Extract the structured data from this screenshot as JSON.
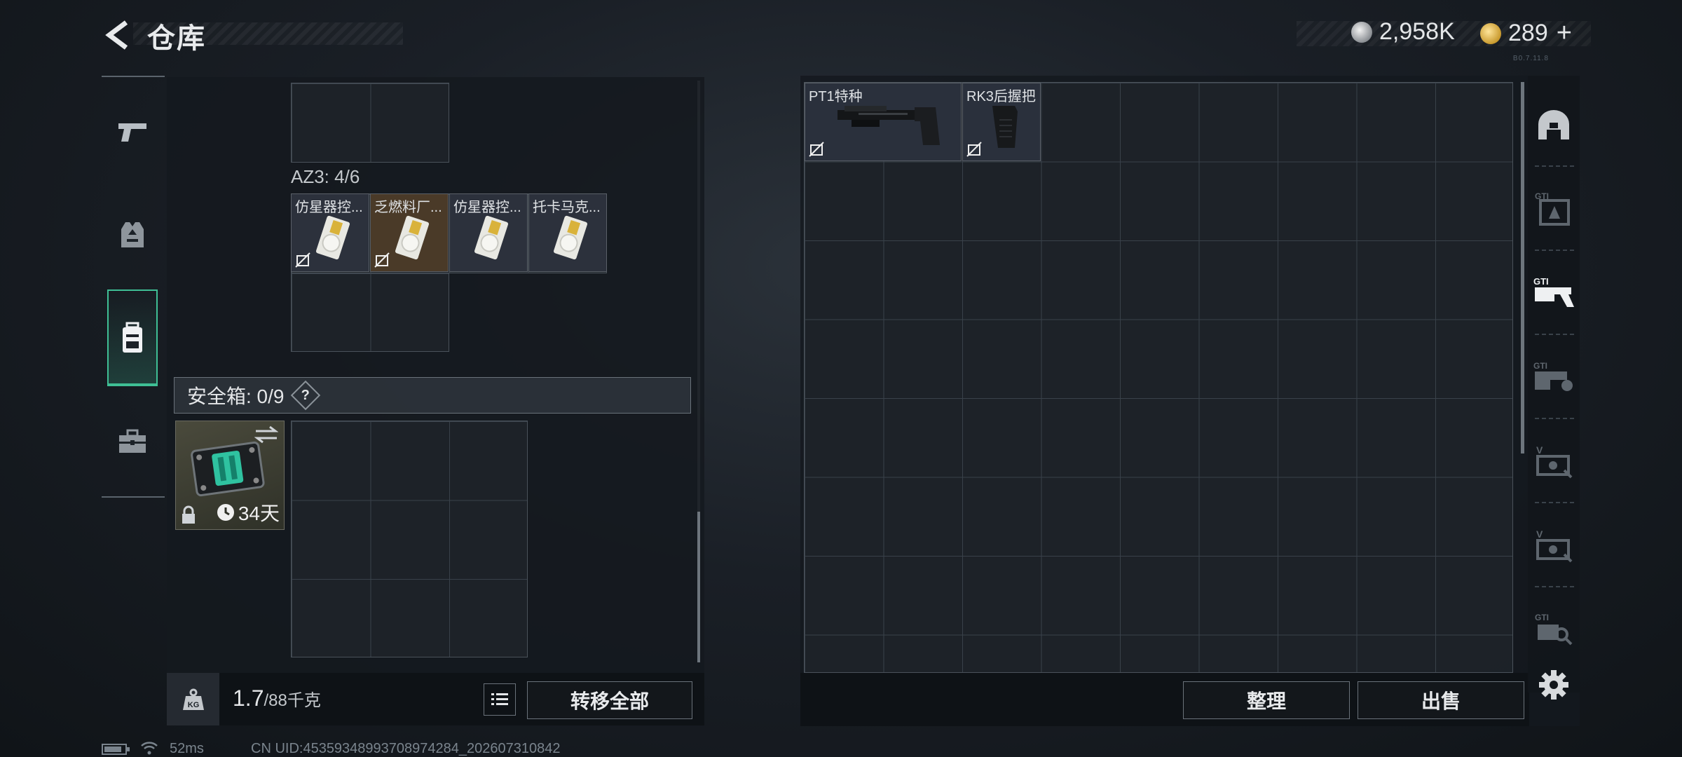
{
  "header": {
    "title": "仓库",
    "currency_silver": "2,958K",
    "currency_gold": "289",
    "plus_label": "+",
    "version": "B0.7.11.8"
  },
  "left_nav": {
    "items": [
      {
        "icon": "pistol-icon"
      },
      {
        "icon": "vest-icon"
      },
      {
        "icon": "backpack-icon",
        "active": true
      },
      {
        "icon": "briefcase-icon"
      }
    ]
  },
  "inventory": {
    "container_label": "AZ3: 4/6",
    "items": [
      {
        "name": "仿星器控...",
        "icon": "keycard-icon"
      },
      {
        "name": "乏燃料厂...",
        "icon": "keycard-icon"
      },
      {
        "name": "仿星器控...",
        "icon": "keycard-icon"
      },
      {
        "name": "托卡马克...",
        "icon": "keycard-icon"
      }
    ],
    "safe_box": {
      "label": "安全箱: 0/9",
      "help": "?",
      "days_left": "34天"
    },
    "weight_current": "1.7",
    "weight_max": "/88千克",
    "transfer_all": "转移全部"
  },
  "stash": {
    "items": [
      {
        "name": "PT1特种",
        "icon": "rifle-stock-icon"
      },
      {
        "name": "RK3后握把",
        "icon": "rear-grip-icon"
      }
    ],
    "sort_label": "整理",
    "sell_label": "出售"
  },
  "right_nav": {
    "items": [
      {
        "icon": "helmet-icon"
      },
      {
        "icon": "gti-armor-icon"
      },
      {
        "icon": "gti-weapon-icon",
        "active": true
      },
      {
        "icon": "gti-ammo-icon"
      },
      {
        "icon": "v-equipment-icon"
      },
      {
        "icon": "v-medical-icon"
      },
      {
        "icon": "gti-tools-icon"
      }
    ]
  },
  "status_bar": {
    "ping": "52ms",
    "uid": "CN UID:45359348993708974284_202607310842"
  },
  "colors": {
    "accent": "#3fbf95",
    "panel": "#14191f"
  }
}
